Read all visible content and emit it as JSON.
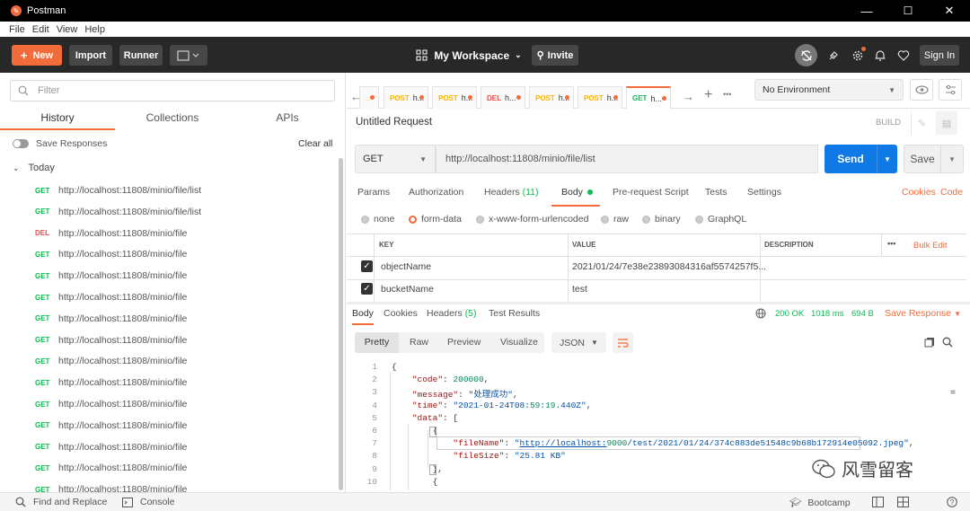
{
  "window": {
    "title": "Postman",
    "minimize": "—",
    "maximize": "☐",
    "close": "✕"
  },
  "menu": [
    "File",
    "Edit",
    "View",
    "Help"
  ],
  "toolbar": {
    "new": "New",
    "import": "Import",
    "runner": "Runner",
    "workspace": "My Workspace",
    "invite": "Invite",
    "signin": "Sign In"
  },
  "sidebar": {
    "filter_placeholder": "Filter",
    "tabs": [
      "History",
      "Collections",
      "APIs"
    ],
    "save_responses": "Save Responses",
    "clear_all": "Clear all",
    "group": "Today",
    "history": [
      {
        "method": "GET",
        "url": "http://localhost:11808/minio/file/list"
      },
      {
        "method": "GET",
        "url": "http://localhost:11808/minio/file/list"
      },
      {
        "method": "DEL",
        "url": "http://localhost:11808/minio/file"
      },
      {
        "method": "GET",
        "url": "http://localhost:11808/minio/file"
      },
      {
        "method": "GET",
        "url": "http://localhost:11808/minio/file"
      },
      {
        "method": "GET",
        "url": "http://localhost:11808/minio/file"
      },
      {
        "method": "GET",
        "url": "http://localhost:11808/minio/file"
      },
      {
        "method": "GET",
        "url": "http://localhost:11808/minio/file"
      },
      {
        "method": "GET",
        "url": "http://localhost:11808/minio/file"
      },
      {
        "method": "GET",
        "url": "http://localhost:11808/minio/file"
      },
      {
        "method": "GET",
        "url": "http://localhost:11808/minio/file"
      },
      {
        "method": "GET",
        "url": "http://localhost:11808/minio/file"
      },
      {
        "method": "GET",
        "url": "http://localhost:11808/minio/file"
      },
      {
        "method": "GET",
        "url": "http://localhost:11808/minio/file"
      },
      {
        "method": "GET",
        "url": "http://localhost:11808/minio/file"
      }
    ]
  },
  "tabs": [
    {
      "method": "POST",
      "name": "h..."
    },
    {
      "method": "POST",
      "name": "h..."
    },
    {
      "method": "DEL",
      "name": "h..."
    },
    {
      "method": "POST",
      "name": "h..."
    },
    {
      "method": "POST",
      "name": "h..."
    },
    {
      "method": "GET",
      "name": "h..."
    }
  ],
  "env": {
    "selected": "No Environment"
  },
  "request": {
    "title": "Untitled Request",
    "build": "BUILD",
    "method": "GET",
    "url": "http://localhost:11808/minio/file/list",
    "send": "Send",
    "save": "Save",
    "subtabs": [
      "Params",
      "Authorization",
      "Headers",
      "Body",
      "Pre-request Script",
      "Tests",
      "Settings"
    ],
    "headers_count": "(11)",
    "cookies": "Cookies",
    "code": "Code",
    "body_types": [
      "none",
      "form-data",
      "x-www-form-urlencoded",
      "raw",
      "binary",
      "GraphQL"
    ],
    "table_head": {
      "key": "KEY",
      "value": "VALUE",
      "desc": "DESCRIPTION",
      "bulk": "Bulk Edit",
      "more": "•••"
    },
    "rows": [
      {
        "key": "objectName",
        "value": "2021/01/24/7e38e23893084316af5574257f5..."
      },
      {
        "key": "bucketName",
        "value": "test"
      }
    ]
  },
  "response": {
    "tabs": [
      "Body",
      "Cookies",
      "Headers",
      "Test Results"
    ],
    "headers_count": "(5)",
    "status": "200 OK",
    "time": "1018 ms",
    "size": "694 B",
    "save": "Save Response",
    "views": [
      "Pretty",
      "Raw",
      "Preview",
      "Visualize"
    ],
    "format": "JSON"
  },
  "code_lines": [
    {
      "n": "1",
      "t": "{"
    },
    {
      "n": "2",
      "t": "    \"code\": 200000,"
    },
    {
      "n": "3",
      "t": "    \"message\": \"处理成功\","
    },
    {
      "n": "4",
      "t": "    \"time\": \"2021-01-24T08:59:19.440Z\","
    },
    {
      "n": "5",
      "t": "    \"data\": ["
    },
    {
      "n": "6",
      "t": "        {"
    },
    {
      "n": "7",
      "t": "            \"fileName\": \"http://localhost:9000/test/2021/01/24/374c883de51548c9b68b172914e05092.jpeg\","
    },
    {
      "n": "8",
      "t": "            \"fileSize\": \"25.81 KB\""
    },
    {
      "n": "9",
      "t": "        },"
    },
    {
      "n": "10",
      "t": "        {"
    }
  ],
  "watermark": "风雪留客",
  "statusbar": {
    "find": "Find and Replace",
    "console": "Console",
    "bootcamp": "Bootcamp"
  },
  "colors": {
    "accent": "#f26b3a",
    "send": "#0f7ae5",
    "get": "#0cbb52",
    "del": "#ed4b48",
    "post": "#ffb400"
  }
}
